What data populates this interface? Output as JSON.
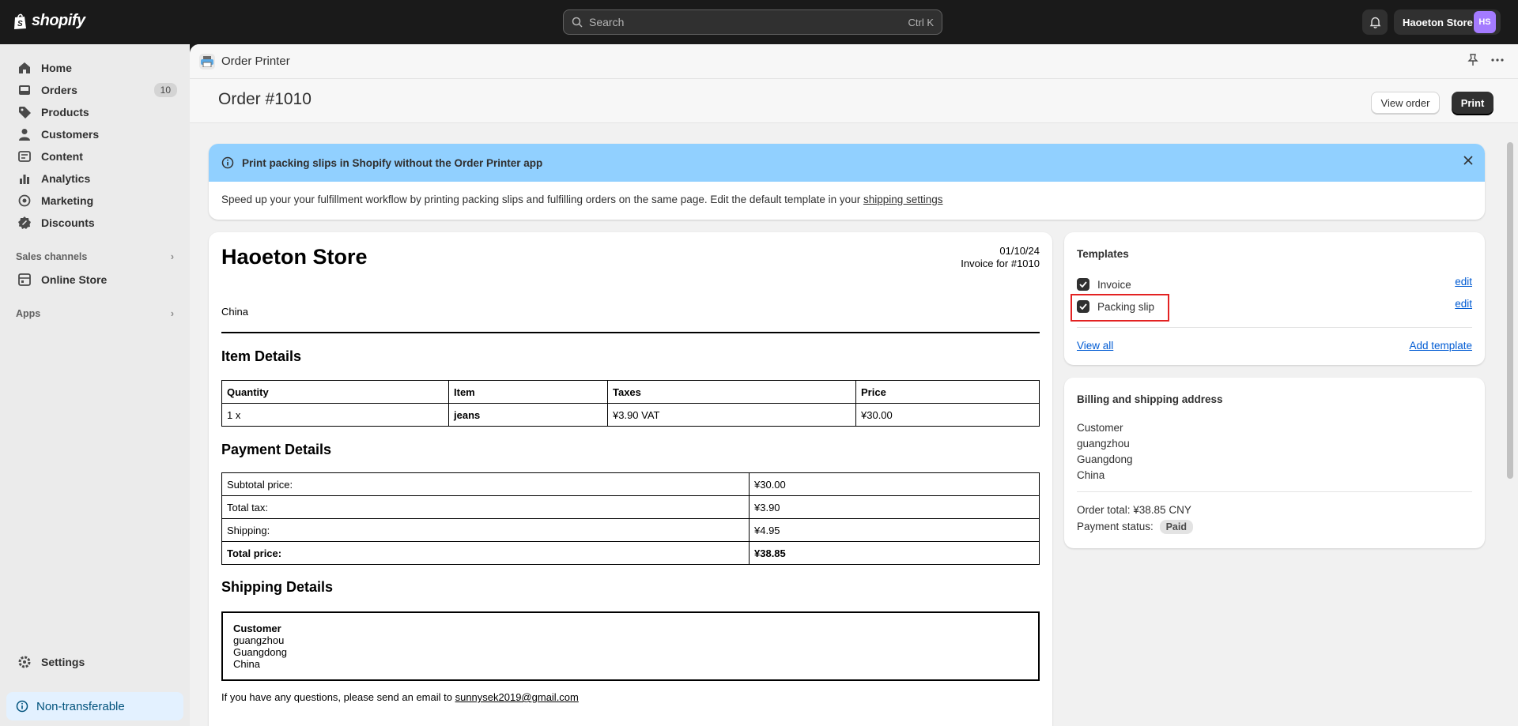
{
  "topbar": {
    "brand": "shopify",
    "search_placeholder": "Search",
    "search_shortcut": "Ctrl K",
    "store_name": "Haoeton Store",
    "avatar_initials": "HS"
  },
  "sidebar": {
    "items": [
      {
        "label": "Home",
        "icon": "home-icon"
      },
      {
        "label": "Orders",
        "icon": "orders-icon",
        "badge": "10"
      },
      {
        "label": "Products",
        "icon": "tag-icon"
      },
      {
        "label": "Customers",
        "icon": "person-icon"
      },
      {
        "label": "Content",
        "icon": "content-icon"
      },
      {
        "label": "Analytics",
        "icon": "bar-chart-icon"
      },
      {
        "label": "Marketing",
        "icon": "target-icon"
      },
      {
        "label": "Discounts",
        "icon": "discount-icon"
      }
    ],
    "sales_channels_label": "Sales channels",
    "online_store_label": "Online Store",
    "apps_label": "Apps",
    "settings_label": "Settings",
    "non_transferable_label": "Non-transferable"
  },
  "appbar": {
    "app_name": "Order Printer"
  },
  "page": {
    "title": "Order #1010",
    "view_order_label": "View order",
    "print_label": "Print"
  },
  "banner": {
    "title": "Print packing slips in Shopify without the Order Printer app",
    "body": "Speed up your your fulfillment workflow by printing packing slips and fulfilling orders on the same page. Edit the default template in your",
    "link_text": "shipping settings"
  },
  "invoice": {
    "store_name": "Haoeton Store",
    "date": "01/10/24",
    "invoice_for": "Invoice for #1010",
    "country": "China",
    "item_details_heading": "Item Details",
    "item_headers": [
      "Quantity",
      "Item",
      "Taxes",
      "Price"
    ],
    "item_rows": [
      {
        "quantity": "1 x",
        "item": "jeans",
        "taxes": "¥3.90 VAT",
        "price": "¥30.00"
      }
    ],
    "payment_details_heading": "Payment Details",
    "payment_rows": [
      {
        "label": "Subtotal price:",
        "value": "¥30.00"
      },
      {
        "label": "Total tax:",
        "value": "¥3.90"
      },
      {
        "label": "Shipping:",
        "value": "¥4.95"
      },
      {
        "label": "Total price:",
        "value": "¥38.85"
      }
    ],
    "shipping_details_heading": "Shipping Details",
    "shipping": {
      "name": "Customer",
      "city": "guangzhou",
      "province": "Guangdong",
      "country": "China"
    },
    "footer_text": "If you have any questions, please send an email to",
    "footer_email": "sunnysek2019@gmail.com"
  },
  "templates_card": {
    "title": "Templates",
    "templates": [
      {
        "label": "Invoice",
        "checked": true,
        "edit_label": "edit"
      },
      {
        "label": "Packing slip",
        "checked": true,
        "edit_label": "edit"
      }
    ],
    "view_all_label": "View all",
    "add_template_label": "Add template"
  },
  "address_card": {
    "title": "Billing and shipping address",
    "lines": [
      "Customer",
      "guangzhou",
      "Guangdong",
      "China"
    ],
    "order_total": "Order total: ¥38.85 CNY",
    "payment_status_label": "Payment status:",
    "payment_status": "Paid"
  },
  "colors": {
    "topbar": "#1a1a1a",
    "banner": "#91d0ff",
    "link": "#005bd3",
    "highlight_box": "#e32222",
    "avatar": "#a47bff"
  }
}
